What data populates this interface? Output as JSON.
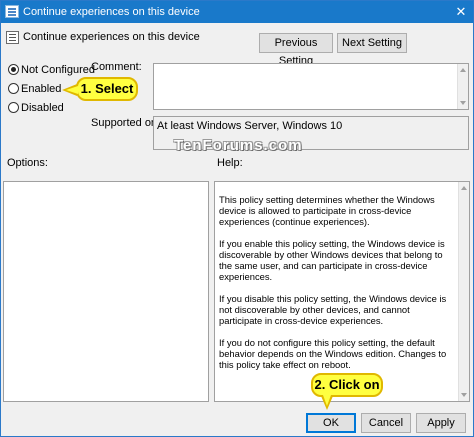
{
  "window": {
    "title": "Continue experiences on this device",
    "controls": {
      "minimize": "—",
      "maximize": "☐",
      "close": "✕"
    }
  },
  "header": {
    "title": "Continue experiences on this device",
    "prev_button": "Previous Setting",
    "next_button": "Next Setting"
  },
  "state": {
    "options": [
      {
        "label": "Not Configured",
        "checked": true
      },
      {
        "label": "Enabled",
        "checked": false
      },
      {
        "label": "Disabled",
        "checked": false
      }
    ]
  },
  "comment": {
    "label": "Comment:",
    "value": ""
  },
  "supported": {
    "label": "Supported on:",
    "value": "At least Windows Server, Windows 10"
  },
  "watermark": "TenForums.com",
  "options_label": "Options:",
  "help": {
    "label": "Help:",
    "paragraphs": [
      "This policy setting determines whether the Windows device is allowed to participate in cross-device experiences (continue experiences).",
      "If you enable this policy setting, the Windows device is discoverable by other Windows devices that belong to the same user, and can participate in cross-device experiences.",
      "If you disable this policy setting, the Windows device is not discoverable by other devices, and cannot participate in cross-device experiences.",
      "If you do not configure this policy setting, the default behavior depends on the Windows edition. Changes to this policy take effect on reboot."
    ]
  },
  "footer": {
    "ok": "OK",
    "cancel": "Cancel",
    "apply": "Apply"
  },
  "callouts": {
    "select": "1. Select",
    "click": "2. Click on"
  }
}
